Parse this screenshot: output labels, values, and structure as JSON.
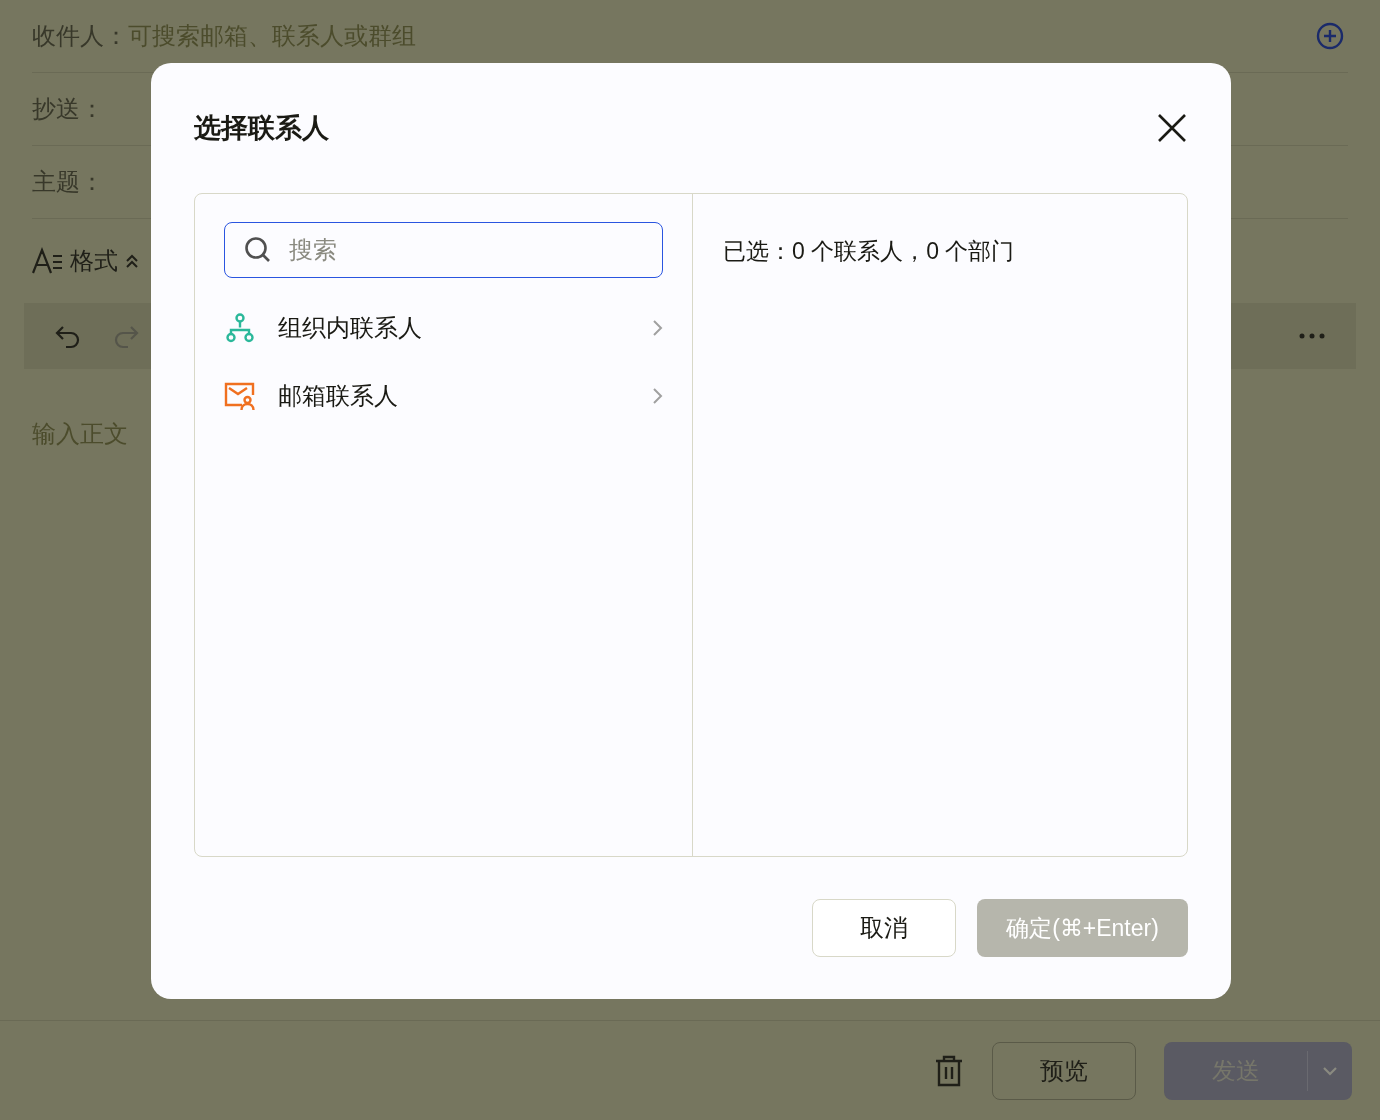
{
  "compose": {
    "to_label": "收件人：",
    "to_placeholder": "可搜索邮箱、联系人或群组",
    "cc_label": "抄送：",
    "subject_label": "主题：",
    "format_label": "格式",
    "body_placeholder": "输入正文"
  },
  "footer": {
    "preview": "预览",
    "send": {
      "label": "发送",
      "disabled": true
    }
  },
  "dialog": {
    "title": "选择联系人",
    "search": {
      "placeholder": "搜索"
    },
    "sources": [
      {
        "label": "组织内联系人",
        "kind": "org"
      },
      {
        "label": "邮箱联系人",
        "kind": "mailbox"
      }
    ],
    "selected_summary": "已选：0 个联系人，0 个部门",
    "cancel": "取消",
    "confirm": {
      "label": "确定(⌘+Enter)",
      "disabled": true
    }
  }
}
